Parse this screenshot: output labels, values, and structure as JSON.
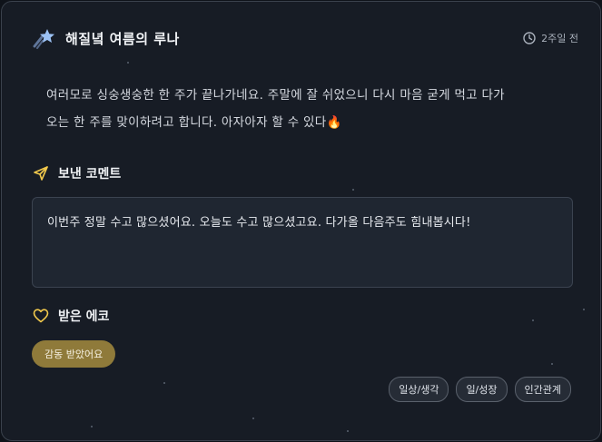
{
  "post": {
    "author": "해질녘 여름의 루나",
    "time_ago": "2주일 전",
    "body_line1": "여러모로 싱숭생숭한 한 주가 끝나가네요. 주말에 잘 쉬었으니 다시 마음 굳게 먹고 다가",
    "body_line2": "오는 한 주를 맞이하려고 합니다. 아자아자 할 수 있다🔥"
  },
  "sent_comment": {
    "title": "보낸 코멘트",
    "text": "이번주 정말 수고 많으셨어요. 오늘도 수고 많으셨고요. 다가올 다음주도 힘내봅시다!"
  },
  "received_echo": {
    "title": "받은 에코",
    "badge": "감동 받았어요"
  },
  "tags": [
    "일상/생각",
    "일/성장",
    "인간관계"
  ],
  "icons": {
    "avatar": "shooting-star-icon",
    "time": "clock-icon",
    "sent": "paper-plane-icon",
    "echo": "heart-icon"
  },
  "colors": {
    "background": "#0f131a",
    "card": "#171c25",
    "accent_yellow": "#f2c94c",
    "badge": "#8f7a3a"
  }
}
